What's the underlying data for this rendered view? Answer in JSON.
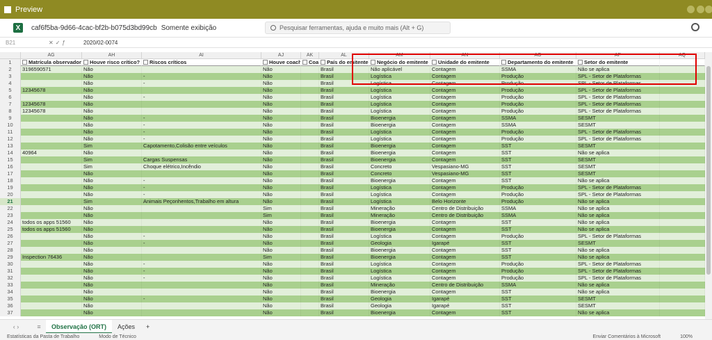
{
  "window": {
    "title": "Preview"
  },
  "app": {
    "filename": "caf6f5ba-9d66-4cac-bf2b-b075d3bd99cb",
    "mode": "Somente exibição",
    "search_placeholder": "Pesquisar ferramentas, ajuda e muito mais (Alt + G)"
  },
  "formula": {
    "cell_ref": "B21",
    "value": "2020/02-0074"
  },
  "columns": [
    "AG",
    "AH",
    "AI",
    "AJ",
    "AK",
    "AL",
    "AM",
    "AN",
    "AO",
    "AP",
    "AQ"
  ],
  "headers": [
    "Matrícula observador",
    "Houve risco crítico?",
    "Riscos críticos",
    "Houve coach?",
    "Coac",
    "País do emitente",
    "Negócio do emitente",
    "Unidade do emitente",
    "Departamento do emitente",
    "Setor do emitente",
    ""
  ],
  "rows": [
    [
      "3196590571",
      "Não",
      "",
      "Não",
      "",
      "Brasil",
      "Não aplicável",
      "Contagem",
      "SSMA",
      "Não se aplica"
    ],
    [
      "",
      "Não",
      "-",
      "Não",
      "",
      "Brasil",
      "Logística",
      "Contagem",
      "Produção",
      "SPL - Setor de Plataformas"
    ],
    [
      "",
      "Não",
      "-",
      "Não",
      "",
      "Brasil",
      "Logística",
      "Contagem",
      "Produção",
      "SPL - Setor de Plataformas"
    ],
    [
      "12345678",
      "Não",
      "",
      "Não",
      "",
      "Brasil",
      "Logística",
      "Contagem",
      "Produção",
      "SPL - Setor de Plataformas"
    ],
    [
      "",
      "Não",
      "-",
      "Não",
      "",
      "Brasil",
      "Logística",
      "Contagem",
      "Produção",
      "SPL - Setor de Plataformas"
    ],
    [
      "12345678",
      "Não",
      "",
      "Não",
      "",
      "Brasil",
      "Logística",
      "Contagem",
      "Produção",
      "SPL - Setor de Plataformas"
    ],
    [
      "12345678",
      "Não",
      "",
      "Não",
      "",
      "Brasil",
      "Logística",
      "Contagem",
      "Produção",
      "SPL - Setor de Plataformas"
    ],
    [
      "",
      "Não",
      "-",
      "Não",
      "",
      "Brasil",
      "Bioenergia",
      "Contagem",
      "SSMA",
      "SESMT"
    ],
    [
      "",
      "Não",
      "-",
      "Não",
      "",
      "Brasil",
      "Bioenergia",
      "Contagem",
      "SSMA",
      "SESMT"
    ],
    [
      "",
      "Não",
      "-",
      "Não",
      "",
      "Brasil",
      "Logística",
      "Contagem",
      "Produção",
      "SPL - Setor de Plataformas"
    ],
    [
      "",
      "Não",
      "-",
      "Não",
      "",
      "Brasil",
      "Logística",
      "Contagem",
      "Produção",
      "SPL - Setor de Plataformas"
    ],
    [
      "",
      "Sim",
      "Capotamento,Colisão entre veículos",
      "Não",
      "",
      "Brasil",
      "Bioenergia",
      "Contagem",
      "SST",
      "SESMT"
    ],
    [
      "40964",
      "Não",
      "",
      "Não",
      "",
      "Brasil",
      "Bioenergia",
      "Contagem",
      "SST",
      "Não se aplica"
    ],
    [
      "",
      "Sim",
      "Cargas Suspensas",
      "Não",
      "",
      "Brasil",
      "Bioenergia",
      "Contagem",
      "SST",
      "SESMT"
    ],
    [
      "",
      "Sim",
      "Choque elétrico,Incêndio",
      "Não",
      "",
      "Brasil",
      "Concreto",
      "Vespasiano-MG",
      "SST",
      "SESMT"
    ],
    [
      "",
      "Não",
      "",
      "Não",
      "",
      "Brasil",
      "Concreto",
      "Vespasiano-MG",
      "SST",
      "SESMT"
    ],
    [
      "",
      "Não",
      "-",
      "Não",
      "",
      "Brasil",
      "Bioenergia",
      "Contagem",
      "SST",
      "Não se aplica"
    ],
    [
      "",
      "Não",
      "-",
      "Não",
      "",
      "Brasil",
      "Logística",
      "Contagem",
      "Produção",
      "SPL - Setor de Plataformas"
    ],
    [
      "",
      "Não",
      "-",
      "Não",
      "",
      "Brasil",
      "Logística",
      "Contagem",
      "Produção",
      "SPL - Setor de Plataformas"
    ],
    [
      "",
      "Sim",
      "Animais Peçonhentos,Trabalho em altura",
      "Não",
      "",
      "Brasil",
      "Logística",
      "Belo Horizonte",
      "Produção",
      "Não se aplica"
    ],
    [
      "",
      "Não",
      "",
      "Sim",
      "",
      "Brasil",
      "Mineração",
      "Centro de Distribuição",
      "SSMA",
      "Não se aplica"
    ],
    [
      "",
      "Não",
      "",
      "Sim",
      "",
      "Brasil",
      "Mineração",
      "Centro de Distribuição",
      "SSMA",
      "Não se aplica"
    ],
    [
      "todos os apps 51560",
      "Não",
      "",
      "Não",
      "",
      "Brasil",
      "Bioenergia",
      "Contagem",
      "SST",
      "Não se aplica"
    ],
    [
      "todos os apps 51560",
      "Não",
      "",
      "Não",
      "",
      "Brasil",
      "Bioenergia",
      "Contagem",
      "SST",
      "Não se aplica"
    ],
    [
      "",
      "Não",
      "-",
      "Não",
      "",
      "Brasil",
      "Logística",
      "Contagem",
      "Produção",
      "SPL - Setor de Plataformas"
    ],
    [
      "",
      "Não",
      "-",
      "Não",
      "",
      "Brasil",
      "Geologia",
      "Igarapé",
      "SST",
      "SESMT"
    ],
    [
      "",
      "Não",
      "",
      "Não",
      "",
      "Brasil",
      "Bioenergia",
      "Contagem",
      "SST",
      "Não se aplica"
    ],
    [
      "Inspection  76436",
      "Não",
      "",
      "Sim",
      "",
      "Brasil",
      "Bioenergia",
      "Contagem",
      "SST",
      "Não se aplica"
    ],
    [
      "",
      "Não",
      "-",
      "Não",
      "",
      "Brasil",
      "Logística",
      "Contagem",
      "Produção",
      "SPL - Setor de Plataformas"
    ],
    [
      "",
      "Não",
      "-",
      "Não",
      "",
      "Brasil",
      "Logística",
      "Contagem",
      "Produção",
      "SPL - Setor de Plataformas"
    ],
    [
      "",
      "Não",
      "-",
      "Não",
      "",
      "Brasil",
      "Logística",
      "Contagem",
      "Produção",
      "SPL - Setor de Plataformas"
    ],
    [
      "",
      "Não",
      "",
      "Não",
      "",
      "Brasil",
      "Mineração",
      "Centro de Distribuição",
      "SSMA",
      "Não se aplica"
    ],
    [
      "",
      "Não",
      "",
      "Não",
      "",
      "Brasil",
      "Bioenergia",
      "Contagem",
      "SST",
      "Não se aplica"
    ],
    [
      "",
      "Não",
      "-",
      "Não",
      "",
      "Brasil",
      "Geologia",
      "Igarapé",
      "SST",
      "SESMT"
    ],
    [
      "",
      "Não",
      "",
      "Não",
      "",
      "Brasil",
      "Geologia",
      "Igarapé",
      "SST",
      "SESMT"
    ],
    [
      "",
      "Não",
      "",
      "Não",
      "",
      "Brasil",
      "Bioenergia",
      "Contagem",
      "SST",
      "Não se aplica"
    ]
  ],
  "sheets": [
    "Observação (ORT)",
    "Ações"
  ],
  "status": [
    "Estatísticas da Pasta de Trabalho",
    "Modo de Técnico",
    "Enviar Comentários à Microsoft",
    "100%"
  ]
}
